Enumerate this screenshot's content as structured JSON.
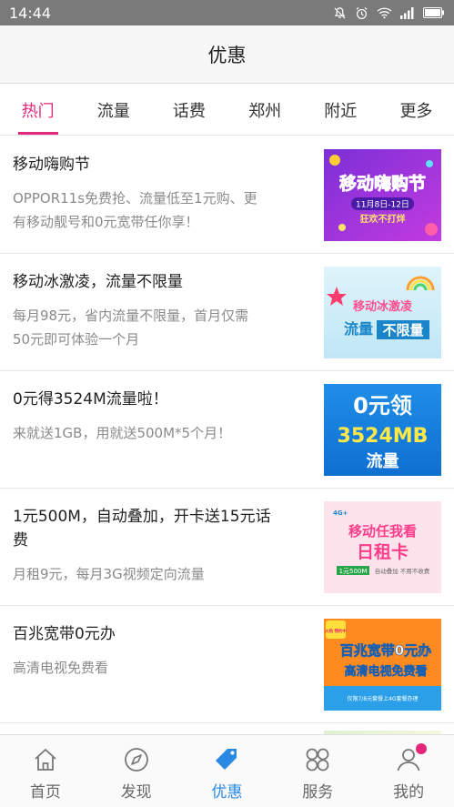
{
  "status_bar": {
    "time": "14:44",
    "icons": [
      "mute-icon",
      "alarm-icon",
      "wifi-icon",
      "signal-icon",
      "battery-icon"
    ]
  },
  "app_bar": {
    "title": "优惠"
  },
  "tabs": [
    {
      "label": "热门",
      "active": true
    },
    {
      "label": "流量",
      "active": false
    },
    {
      "label": "话费",
      "active": false
    },
    {
      "label": "郑州",
      "active": false
    },
    {
      "label": "附近",
      "active": false
    },
    {
      "label": "更多",
      "active": false
    }
  ],
  "items": [
    {
      "title": "移动嗨购节",
      "desc": [
        "OPPOR11s免费抢、流量低至1元购、更",
        "有移动靓号和0元宽带任你享！"
      ],
      "thumb": {
        "line1": "移动嗨购节",
        "line2": "11月8日-12日",
        "line3": "狂欢不打烊"
      }
    },
    {
      "title": "移动冰激凌，流量不限量",
      "desc": [
        "每月98元，省内流量不限量，首月仅需",
        "50元即可体验一个月"
      ],
      "thumb": {
        "line1": "移动冰激凌",
        "line2": "流量",
        "line3": "不限量"
      }
    },
    {
      "title": "0元得3524M流量啦！",
      "desc": [
        "来就送1GB，用就送500M*5个月！"
      ],
      "thumb": {
        "line1": "0元领",
        "line2": "3524MB",
        "line3": "流量"
      }
    },
    {
      "title_lines": [
        "1元500M，自动叠加，开卡送15元话",
        "费"
      ],
      "desc": [
        "月租9元，每月3G视频定向流量"
      ],
      "thumb": {
        "line1": "移动任我看",
        "line2": "日租卡",
        "line3": "1元500M",
        "line4": "自动叠加 不用不收费"
      }
    },
    {
      "title": "百兆宽带0元办",
      "desc": [
        "高清电视免费看"
      ],
      "thumb": {
        "line1": "火热 预约中",
        "line2": "百兆宽带0元办",
        "line3": "高清电视免费看",
        "line4": "仅限7/8元套餐上4G套餐办理"
      }
    }
  ],
  "bottom_nav": [
    {
      "label": "首页",
      "icon": "home-icon",
      "active": false
    },
    {
      "label": "发现",
      "icon": "compass-icon",
      "active": false
    },
    {
      "label": "优惠",
      "icon": "tag-icon",
      "active": true
    },
    {
      "label": "服务",
      "icon": "grid-icon",
      "active": false
    },
    {
      "label": "我的",
      "icon": "user-icon",
      "active": false,
      "badge": true
    }
  ],
  "colors": {
    "accent": "#e4267a",
    "nav_active": "#2a89e2",
    "status_bar": "#7a7a7a",
    "secondary_text": "#8a8a8a"
  }
}
